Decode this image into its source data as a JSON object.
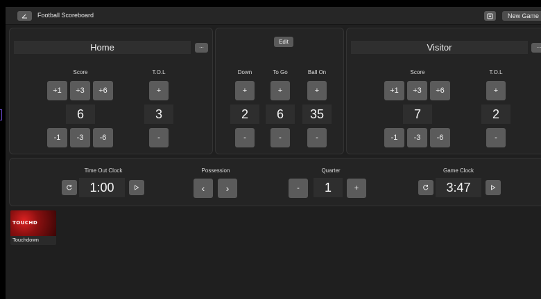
{
  "window": {
    "title": "Football Scoreboard",
    "new_game_label": "New Game"
  },
  "home": {
    "name": "Home",
    "more_label": "...",
    "score_label": "Score",
    "tol_label": "T.O.L",
    "score": "6",
    "tol": "3",
    "plus_buttons": [
      "+1",
      "+3",
      "+6"
    ],
    "minus_buttons": [
      "-1",
      "-3",
      "-6"
    ],
    "tol_plus": "+",
    "tol_minus": "-"
  },
  "middle": {
    "edit_label": "Edit",
    "down_label": "Down",
    "togo_label": "To Go",
    "ballon_label": "Ball On",
    "down": "2",
    "togo": "6",
    "ballon": "35",
    "plus": "+",
    "minus": "-"
  },
  "visitor": {
    "name": "Visitor",
    "more_label": "...",
    "score_label": "Score",
    "tol_label": "T.O.L",
    "score": "7",
    "tol": "2",
    "plus_buttons": [
      "+1",
      "+3",
      "+6"
    ],
    "minus_buttons": [
      "-1",
      "-3",
      "-6"
    ],
    "tol_plus": "+",
    "tol_minus": "-"
  },
  "bottom": {
    "timeout_label": "Time Out Clock",
    "timeout_value": "1:00",
    "possession_label": "Possession",
    "prev_arrow": "‹",
    "next_arrow": "›",
    "quarter_label": "Quarter",
    "quarter_value": "1",
    "quarter_minus": "-",
    "quarter_plus": "+",
    "gameclock_label": "Game Clock",
    "gameclock_value": "3:47"
  },
  "gallery": {
    "items": [
      {
        "thumb_text": "TOUCHD",
        "caption": "Touchdown"
      }
    ]
  },
  "colors": {
    "background": "#1f1f1f",
    "panel": "#242424",
    "button": "#5b5b5b",
    "value_box": "#2e2e2e",
    "thumb_red": "#d22222"
  },
  "icons": [
    "edit-icon",
    "save-icon",
    "reset-icon",
    "play-icon"
  ]
}
